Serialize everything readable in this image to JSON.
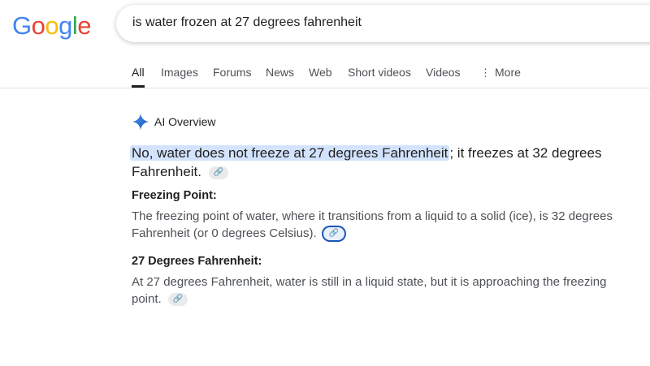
{
  "logo": {
    "letters": [
      "G",
      "o",
      "o",
      "g",
      "l",
      "e"
    ],
    "colors": [
      "#4285F4",
      "#EA4335",
      "#FBBC05",
      "#4285F4",
      "#34A853",
      "#EA4335"
    ]
  },
  "search": {
    "value": "is water frozen at 27 degrees fahrenheit"
  },
  "tabs": [
    {
      "label": "All",
      "active": true
    },
    {
      "label": "Images"
    },
    {
      "label": "Forums"
    },
    {
      "label": "News"
    },
    {
      "label": "Web"
    },
    {
      "label": "Short videos"
    },
    {
      "label": "Videos"
    },
    {
      "label": "More",
      "icon": "vertical-dots-icon"
    }
  ],
  "ai_overview": {
    "title": "AI Overview",
    "icon": "sparkle-icon",
    "answer_highlight": "No, water does not freeze at 27 degrees Fahrenheit",
    "answer_rest": "; it freezes at 32 degrees Fahrenheit.",
    "sections": [
      {
        "heading": "Freezing Point:",
        "body": "The freezing point of water, where it transitions from a liquid to a solid (ice), is 32 degrees Fahrenheit (or 0 degrees Celsius)."
      },
      {
        "heading": "27 Degrees Fahrenheit:",
        "body": "At 27 degrees Fahrenheit, water is still in a liquid state, but it is approaching the freezing point."
      }
    ],
    "link_icon": "link-icon",
    "link_glyph": "🔗"
  }
}
